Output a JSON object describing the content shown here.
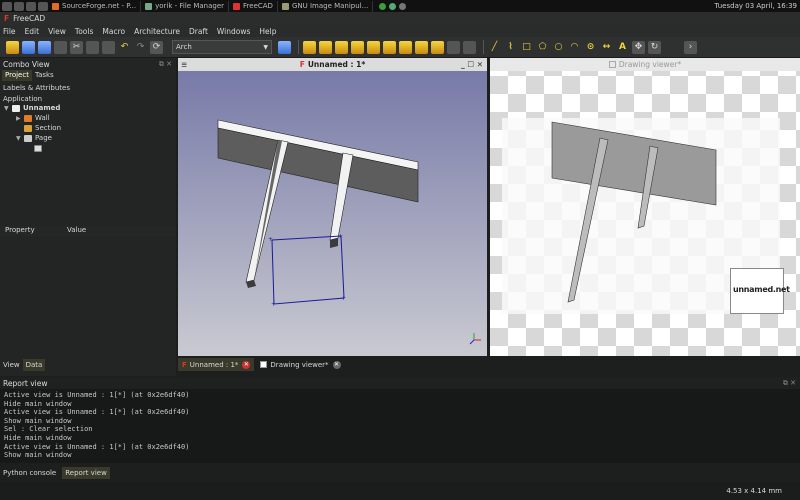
{
  "taskbar": {
    "tasks": [
      "SourceForge.net - P...",
      "yorik - File Manager",
      "FreeCAD",
      "GNU Image Manipul..."
    ],
    "clock": "Tuesday 03 April, 16:39"
  },
  "window": {
    "title": "FreeCAD"
  },
  "menu": [
    "File",
    "Edit",
    "View",
    "Tools",
    "Macro",
    "Architecture",
    "Draft",
    "Windows",
    "Help"
  ],
  "toolbar": {
    "workbench": "Arch"
  },
  "combo": {
    "title": "Combo View",
    "tabs": [
      "Project",
      "Tasks"
    ],
    "section": "Labels & Attributes",
    "app_label": "Application",
    "tree": [
      {
        "label": "Unnamed",
        "level": 0,
        "bold": true,
        "expand": "▼"
      },
      {
        "label": "Wall",
        "level": 1,
        "expand": "▶"
      },
      {
        "label": "Section",
        "level": 1,
        "expand": ""
      },
      {
        "label": "Page",
        "level": 1,
        "expand": "▼"
      },
      {
        "label": "",
        "level": 2,
        "expand": ""
      }
    ],
    "prop_cols": [
      "Property",
      "Value"
    ],
    "bottom_tabs": [
      "View",
      "Data"
    ]
  },
  "views": {
    "main_title": "Unnamed : 1*",
    "drawing_title": "Drawing viewer*",
    "tabs": [
      "Unnamed : 1*",
      "Drawing viewer*"
    ]
  },
  "stamp": {
    "logo": "unnamed.net"
  },
  "report": {
    "title": "Report view",
    "lines": [
      "Active view is Unnamed : 1[*] (at 0x2e6df40)",
      "Hide main window",
      "Active view is Unnamed : 1[*] (at 0x2e6df40)",
      "Show main window",
      "Sel : Clear selection",
      "Hide main window",
      "Active view is Unnamed : 1[*] (at 0x2e6df40)",
      "Show main window"
    ]
  },
  "bottom_tabs": [
    "Python console",
    "Report view"
  ],
  "status": {
    "dimensions": "4.53 x 4.14 mm"
  },
  "colors": {
    "accent": "#f1d43a",
    "viewport_top": "#7476a6",
    "viewport_bottom": "#c9cad1",
    "section_line": "#1a1a99"
  }
}
